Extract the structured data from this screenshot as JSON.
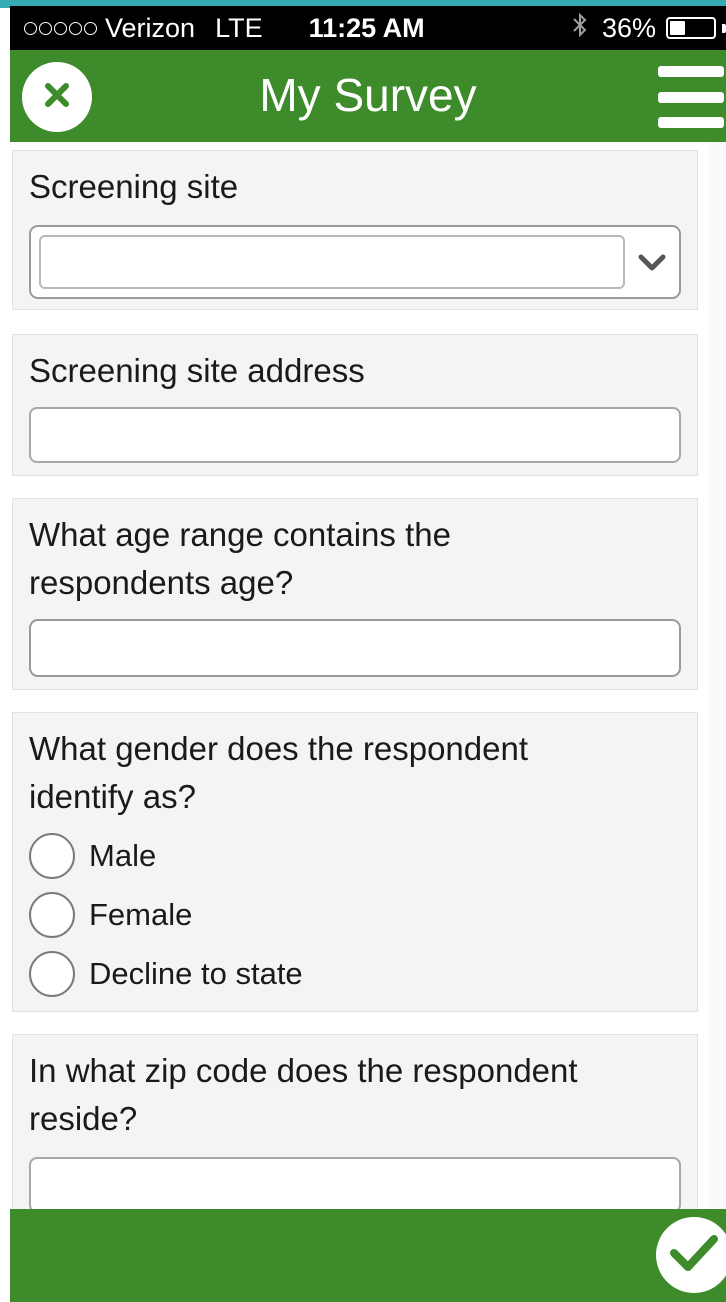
{
  "status_bar": {
    "carrier": "Verizon",
    "network": "LTE",
    "time": "11:25 AM",
    "battery_percent": "36%",
    "battery_level": 0.36,
    "bluetooth_icon": "bluetooth-icon"
  },
  "header": {
    "title": "My Survey",
    "close_icon": "close-icon",
    "menu_icon": "hamburger-menu-icon"
  },
  "questions": {
    "screening_site": {
      "label": "Screening site",
      "value": ""
    },
    "screening_site_address": {
      "label": "Screening site address",
      "value": ""
    },
    "age_range": {
      "label_line1": "What age range contains the",
      "label_line2": "respondents age?",
      "value": ""
    },
    "gender": {
      "label_line1": "What gender does the respondent",
      "label_line2": "identify as?",
      "options": [
        "Male",
        "Female",
        "Decline to state"
      ]
    },
    "zip_code": {
      "label_line1": "In what zip code does the respondent",
      "label_line2": "reside?",
      "value": ""
    }
  },
  "footer": {
    "submit_icon": "checkmark-icon"
  },
  "colors": {
    "header_green": "#3d8b2a",
    "status_bar": "#000000",
    "card_bg": "#f4f4f4",
    "accent_teal": "#36aab4"
  }
}
